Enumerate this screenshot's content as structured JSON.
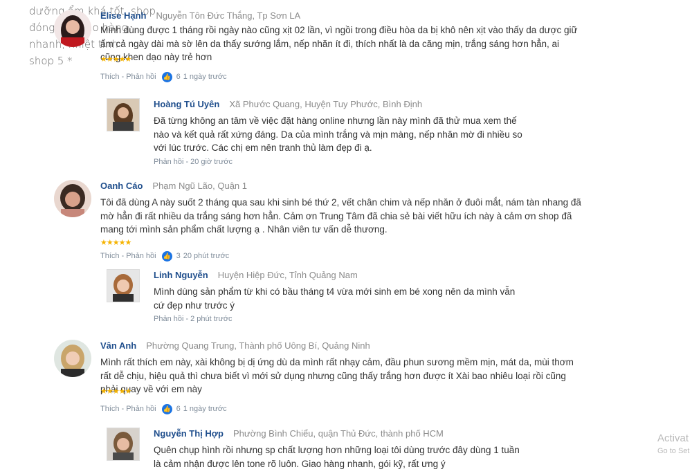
{
  "background_text": {
    "lines": [
      "dưỡng ẩm khá tốt, shop",
      "đóng gói giao hàng",
      "nhanh, nhiệt tình",
      "shop 5 *"
    ]
  },
  "comments": [
    {
      "name": "Elise Hạnh",
      "location": "Nguyễn Tôn Đức Thắng, Tp Sơn LA",
      "text": "Mình dùng được 1 tháng rồi ngày nào cũng xịt 02 lần, vì ngồi trong điều hòa da bị khô nên xịt vào thấy da dược giữ ẩm cả ngày dài mà sờ lên da thấy sướng lắm, nếp nhăn ít đi, thích nhất là da căng mịn, trắng sáng hơn hẳn, ai cũng khen dạo này trẻ hơn",
      "stars": "★★★★★",
      "like_label": "Thích",
      "reply_label": "Phản hồi",
      "likes": "6",
      "time": "1 ngày trước",
      "reply": {
        "name": "Hoàng Tú Uyên",
        "location": "Xã Phước Quang, Huyện Tuy Phước, Bình Định",
        "text": "Đã từng không an tâm về việc đặt hàng online nhưng lần này mình đã thử mua xem thế nào và kết quả rất xứng đáng. Da của mình trắng và mịn màng, nếp nhăn mờ đi nhiều so với lúc trước. Các chị em nên tranh thủ làm đẹp đi ạ.",
        "reply_label": "Phản hồi",
        "time": "20 giờ trước"
      }
    },
    {
      "name": "Oanh Cáo",
      "location": "Phạm Ngũ Lão, Quận 1",
      "text": "Tôi đã dùng A này suốt 2 tháng qua sau khi sinh bé thứ 2, vết chân chim và nếp nhăn ở đuôi mắt, nám tàn nhang đã mờ hẳn đi rất nhiều da trắng sáng hơn hẳn. Cảm ơn Trung Tâm đã chia sẻ bài viết hữu ích này à cảm ơn shop đã mang tới mình sản phẩm chất lượng ạ . Nhân viên tư vấn dễ thương.",
      "stars": "★★★★★",
      "like_label": "Thích",
      "reply_label": "Phản hồi",
      "likes": "3",
      "time": "20 phút trước",
      "reply": {
        "name": "Linh Nguyễn",
        "location": "Huyện Hiệp Đức, Tỉnh Quảng Nam",
        "text": "Mình dùng sản phẩm từ khi có bầu tháng t4 vừa mới sinh em bé xong nên da mình vẫn cứ đẹp như trước ý",
        "reply_label": "Phản hồi",
        "time": "2 phút trước"
      }
    },
    {
      "name": "Vân Anh",
      "location": "Phường Quang Trung, Thành phố Uông Bí, Quảng Ninh",
      "text": "Mình rất thích em này, xài không bị dị ứng dù da mình rất nhạy cảm, đầu phun sương mềm mịn, mát da, mùi thơm rất dễ chịu, hiệu quả thì chưa biết vì mới sử dụng nhưng cũng thấy trắng hơn được ít Xài bao nhiêu loại rồi cũng phải quay về với em này",
      "stars": "★★★★★",
      "like_label": "Thích",
      "reply_label": "Phản hồi",
      "likes": "6",
      "time": "1 ngày trước",
      "reply": {
        "name": "Nguyễn Thị Hợp",
        "location": "Phường Bình Chiểu, quận Thủ Đức, thành phố HCM",
        "text": "Quên chụp hình rồi nhưng sp chất lượng hơn những loại tôi dùng trước đây dùng 1 tuần là cảm nhận được lên tone rõ luôn. Giao hàng nhanh, gói kỹ, rất ưng ý"
      }
    }
  ],
  "watermark": {
    "line1": "Activat",
    "line2": "Go to Set"
  }
}
